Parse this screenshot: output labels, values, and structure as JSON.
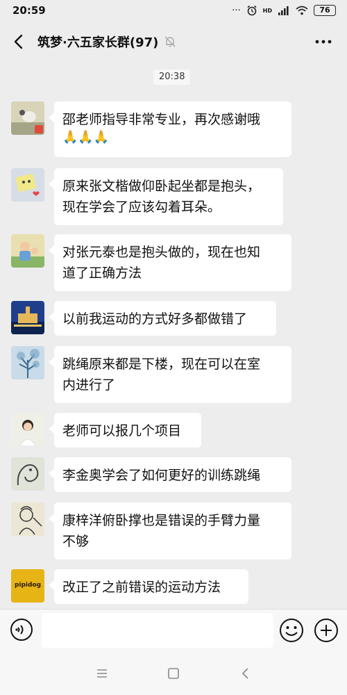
{
  "status_bar": {
    "time": "20:59",
    "battery": "76",
    "network": "HD"
  },
  "header": {
    "title": "筑梦·六五家长群(97)",
    "back_icon": "chevron-left-icon",
    "mute_icon": "bell-muted-icon",
    "more_icon": "more-horizontal-icon"
  },
  "chat": {
    "timestamp": "20:38",
    "messages": [
      {
        "text": "邵老师指导非常专业，再次感谢哦",
        "emoji": "🙏🙏🙏"
      },
      {
        "text_lines": [
          "原来张文楷做仰卧起坐都是抱头，",
          "现在学会了应该勾着耳朵。"
        ]
      },
      {
        "text_lines": [
          "对张元泰也是抱头做的，现在也知",
          "道了正确方法"
        ]
      },
      {
        "text": "以前我运动的方式好多都做错了"
      },
      {
        "text_lines": [
          "跳绳原来都是下楼，现在可以在室",
          "内进行了"
        ]
      },
      {
        "text": "老师可以报几个项目"
      },
      {
        "text": "李金奥学会了如何更好的训练跳绳"
      },
      {
        "text_lines": [
          "康梓洋俯卧撑也是错误的手臂力量",
          "不够"
        ]
      },
      {
        "text": "改正了之前错误的运动方法",
        "avatar_text": "pipidog"
      }
    ]
  },
  "input_bar": {
    "placeholder": "",
    "voice_icon": "voice-icon",
    "emoji_icon": "smiley-icon",
    "plus_icon": "plus-icon"
  },
  "navigation": {
    "menu_icon": "menu-icon",
    "home_icon": "square-icon",
    "back_icon": "triangle-back-icon"
  }
}
